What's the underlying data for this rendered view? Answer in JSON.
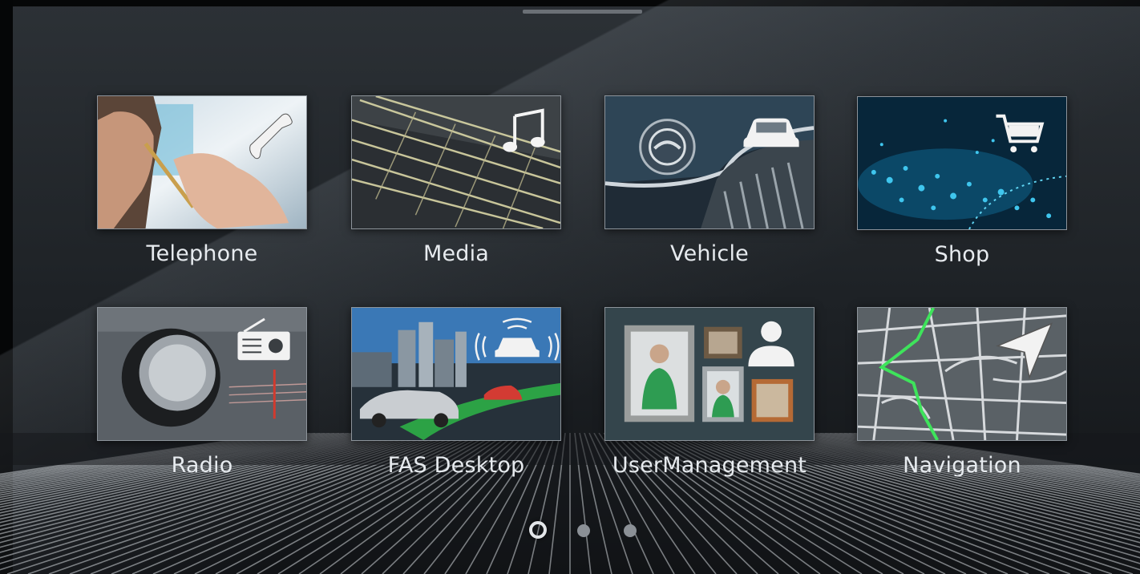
{
  "apps": [
    {
      "label": "Telephone",
      "icon": "telephone-icon"
    },
    {
      "label": "Media",
      "icon": "music-note-icon"
    },
    {
      "label": "Vehicle",
      "icon": "car-icon"
    },
    {
      "label": "Shop",
      "icon": "shopping-cart-icon"
    },
    {
      "label": "Radio",
      "icon": "radio-icon"
    },
    {
      "label": "FAS Desktop",
      "icon": "car-sensors-icon"
    },
    {
      "label": "UserManagement",
      "icon": "user-profile-icon"
    },
    {
      "label": "Navigation",
      "icon": "navigation-arrow-icon"
    }
  ],
  "pager": {
    "pages": 3,
    "current_page": 1
  },
  "colors": {
    "label_text": "#e7ebef",
    "tile_border": "#8d949b",
    "background": "#1d2125",
    "dot_inactive": "#8b9096",
    "dot_active": "#e3e6e9"
  }
}
